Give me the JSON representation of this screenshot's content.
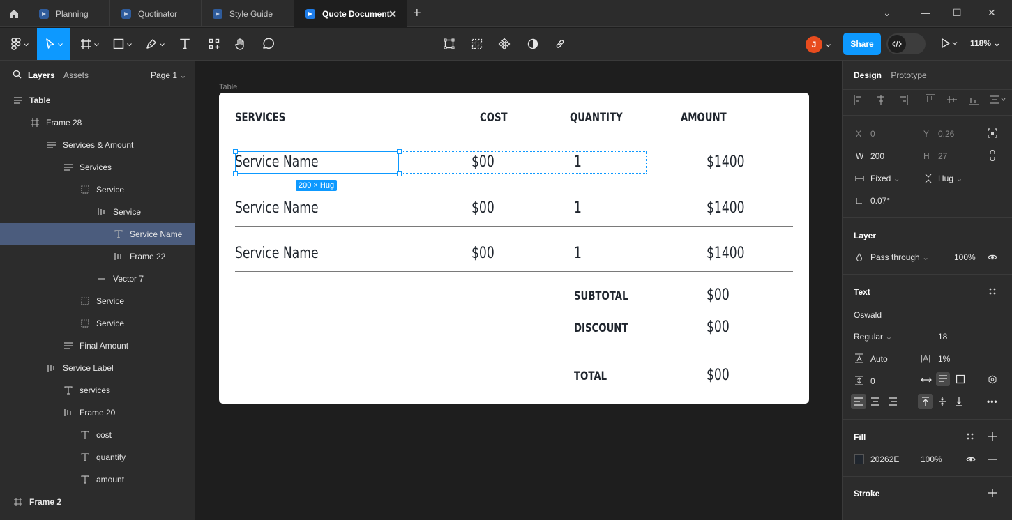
{
  "tabs": [
    {
      "label": "Planning"
    },
    {
      "label": "Quotinator"
    },
    {
      "label": "Style Guide"
    },
    {
      "label": "Quote Document",
      "active": true
    }
  ],
  "toolbar": {
    "avatar_initial": "J",
    "share_label": "Share",
    "zoom": "118%"
  },
  "left_panel": {
    "tab_layers": "Layers",
    "tab_assets": "Assets",
    "page": "Page 1",
    "layers": [
      {
        "name": "Table",
        "icon": "auto-layout-vertical-icon",
        "depth": 0
      },
      {
        "name": "Frame 28",
        "icon": "frame-icon",
        "depth": 1
      },
      {
        "name": "Services & Amount",
        "icon": "auto-layout-vertical-icon",
        "depth": 2
      },
      {
        "name": "Services",
        "icon": "auto-layout-vertical-icon",
        "depth": 3
      },
      {
        "name": "Service",
        "icon": "dashed-frame-icon",
        "depth": 4
      },
      {
        "name": "Service",
        "icon": "auto-layout-horizontal-icon",
        "depth": 5
      },
      {
        "name": "Service Name",
        "icon": "text-icon",
        "depth": 6,
        "selected": true
      },
      {
        "name": "Frame 22",
        "icon": "auto-layout-horizontal-icon",
        "depth": 6
      },
      {
        "name": "Vector 7",
        "icon": "line-icon",
        "depth": 5
      },
      {
        "name": "Service",
        "icon": "dashed-frame-icon",
        "depth": 4
      },
      {
        "name": "Service",
        "icon": "dashed-frame-icon",
        "depth": 4
      },
      {
        "name": "Final Amount",
        "icon": "auto-layout-vertical-icon",
        "depth": 3
      },
      {
        "name": "Service Label",
        "icon": "auto-layout-horizontal-icon",
        "depth": 2
      },
      {
        "name": "services",
        "icon": "text-icon",
        "depth": 3
      },
      {
        "name": "Frame 20",
        "icon": "auto-layout-horizontal-icon",
        "depth": 3
      },
      {
        "name": "cost",
        "icon": "text-icon",
        "depth": 4
      },
      {
        "name": "quantity",
        "icon": "text-icon",
        "depth": 4
      },
      {
        "name": "amount",
        "icon": "text-icon",
        "depth": 4
      },
      {
        "name": "Frame 2",
        "icon": "frame-icon",
        "depth": 0
      }
    ]
  },
  "canvas": {
    "frame_label": "Table",
    "headers": {
      "services": "SERVICES",
      "cost": "COST",
      "quantity": "QUANTITY",
      "amount": "AMOUNT"
    },
    "rows": [
      {
        "name": "Service Name",
        "cost": "$00",
        "qty": "1",
        "amount": "$1400"
      },
      {
        "name": "Service Name",
        "cost": "$00",
        "qty": "1",
        "amount": "$1400"
      },
      {
        "name": "Service Name",
        "cost": "$00",
        "qty": "1",
        "amount": "$1400"
      }
    ],
    "subtotal_label": "SUBTOTAL",
    "subtotal_value": "$00",
    "discount_label": "DISCOUNT",
    "discount_value": "$00",
    "total_label": "TOTAL",
    "total_value": "$00",
    "size_badge": "200 × Hug"
  },
  "right_panel": {
    "tab_design": "Design",
    "tab_prototype": "Prototype",
    "x_label": "X",
    "x_value": "0",
    "y_label": "Y",
    "y_value": "0.26",
    "w_label": "W",
    "w_value": "200",
    "h_label": "H",
    "h_value": "27",
    "width_mode": "Fixed",
    "height_mode": "Hug",
    "rotation": "0.07°",
    "layer_title": "Layer",
    "blend_mode": "Pass through",
    "opacity": "100%",
    "text_title": "Text",
    "font_family": "Oswald",
    "font_weight": "Regular",
    "font_size": "18",
    "line_height": "Auto",
    "letter_spacing": "1%",
    "paragraph_spacing": "0",
    "fill_title": "Fill",
    "fill_hex": "20262E",
    "fill_opacity": "100%",
    "stroke_title": "Stroke"
  },
  "colors": {
    "accent": "#0d99ff",
    "selected_layer": "#4b5c7d",
    "text_fill": "#20262E"
  }
}
